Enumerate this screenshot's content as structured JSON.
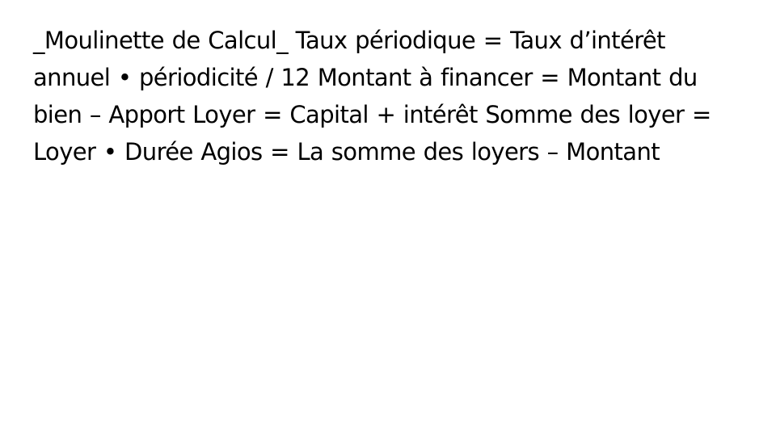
{
  "slide": {
    "body_text": "_Moulinette de Calcul_ Taux périodique = Taux d’intérêt annuel • périodicité / 12 Montant à financer = Montant du bien – Apport Loyer = Capital + intérêt Somme des loyer = Loyer • Durée Agios = La somme des loyers – Montant"
  },
  "colors": {
    "background": "#ffffff",
    "text": "#000000"
  }
}
